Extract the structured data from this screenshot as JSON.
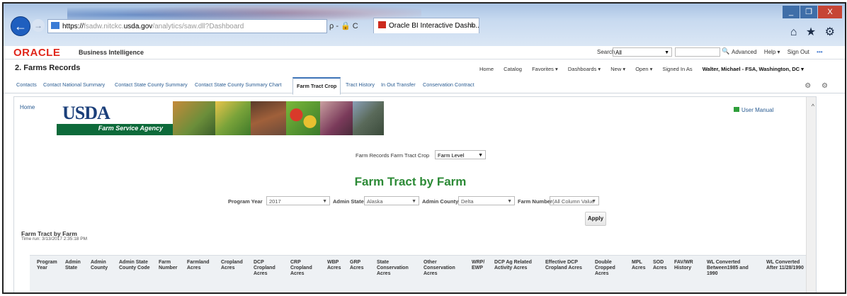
{
  "browser": {
    "address_prefix": "https://",
    "address_dim1": "fsadw.nitckc.",
    "address_host": "usda.gov",
    "address_dim2": "/analytics/saw.dll?Dashboard",
    "address_tools": "ρ - 🔒 C",
    "tab_title": "Oracle BI Interactive Dashb...",
    "tab_close": "×",
    "minimize": "_",
    "maximize": "❐",
    "close": "X",
    "toolbar_icons": "⌂ ★ ⚙"
  },
  "obi_header": {
    "logo": "ORACLE",
    "product": "Business Intelligence",
    "search_label": "Search",
    "search_scope": "All",
    "advanced": "Advanced",
    "help": "Help ▾",
    "sign_out": "Sign Out",
    "more": "•••"
  },
  "dashboard": {
    "title": "2. Farms Records",
    "nav": [
      "Home",
      "Catalog",
      "Favorites ▾",
      "Dashboards ▾",
      "New ▾",
      "Open ▾"
    ],
    "signed_in_label": "Signed In As",
    "signed_in_user": "Walter, Michael - FSA, Washington, DC ▾"
  },
  "tabs": [
    {
      "label": "Contacts"
    },
    {
      "label": "Contact National Summary"
    },
    {
      "label": "Contact State County Summary"
    },
    {
      "label": "Contact State County Summary Chart"
    },
    {
      "label": "Farm Tract Crop"
    },
    {
      "label": "Tract History"
    },
    {
      "label": "In Out Transfer"
    },
    {
      "label": "Conservation Contract"
    }
  ],
  "tab_icons": "⚙ ⚙",
  "content": {
    "home_link": "Home",
    "user_manual": "User Manual",
    "usda": "USDA",
    "agency": "Farm Service Agency",
    "farm_level_label": "Farm Records Farm Tract Crop",
    "farm_level_value": "Farm Level",
    "report_title": "Farm Tract by Farm",
    "prompts": {
      "program_year_label": "Program Year",
      "program_year_value": "2017",
      "admin_state_label": "Admin State",
      "admin_state_value": "Alaska",
      "admin_county_label": "Admin County",
      "admin_county_value": "Delta",
      "farm_number_label": "Farm Number",
      "farm_number_value": "(All Column Value"
    },
    "apply": "Apply",
    "table_title": "Farm Tract by Farm",
    "time_run": "Time run: 3/13/2017 2:35:18 PM",
    "columns": [
      "Program Year",
      "Admin State",
      "Admin County",
      "Admin State County Code",
      "Farm Number",
      "Farmland Acres",
      "Cropland Acres",
      "DCP Cropland Acres",
      "CRP Cropland Acres",
      "WBP Acres",
      "GRP Acres",
      "State Conservation Acres",
      "Other Conservation Acres",
      "WRP/ EWP",
      "DCP Ag Related Activity Acres",
      "Effective DCP Cropland Acres",
      "Double Cropped Acres",
      "MPL Acres",
      "SOD Acres",
      "FAV/WR History",
      "WL Converted Between1985 and 1990",
      "WL Converted After 11/28/1990"
    ]
  },
  "colors": {
    "oracle_red": "#e0261b",
    "title_green": "#2c8a36",
    "link_blue": "#2b5d93",
    "usda_green": "#0d6a3a"
  }
}
